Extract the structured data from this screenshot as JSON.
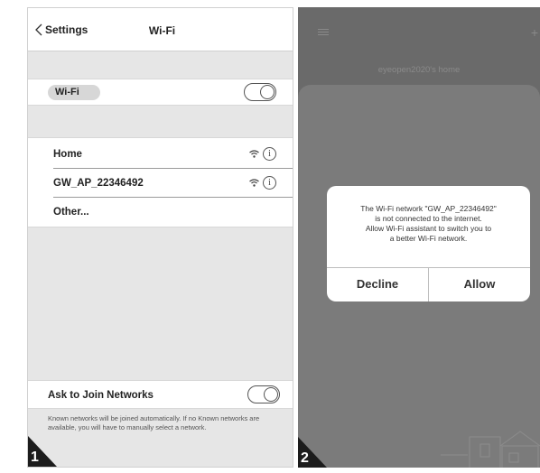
{
  "panel1": {
    "nav": {
      "back_label": "Settings",
      "title": "Wi-Fi"
    },
    "wifi": {
      "label": "Wi-Fi",
      "toggle": "off"
    },
    "networks": [
      {
        "name": "Home"
      },
      {
        "name": "GW_AP_22346492"
      },
      {
        "name": "Other..."
      }
    ],
    "ask_to_join": {
      "label": "Ask to Join Networks",
      "toggle": "off",
      "description": "Known networks will be joined automatically. If no Known networks are available, you will have to manually select a network."
    },
    "step_number": "1"
  },
  "panel2": {
    "home_title": "eyeopen2020's home",
    "plus_icon": "+",
    "dialog": {
      "message_line1": "The Wi-Fi network \"GW_AP_22346492\"",
      "message_line2": "is not connected to the internet.",
      "message_line3": "Allow Wi-Fi assistant to switch you to",
      "message_line4": "a better Wi-Fi network.",
      "decline_label": "Decline",
      "allow_label": "Allow"
    },
    "step_number": "2"
  },
  "icons": [
    "chevron-left-icon",
    "wifi-icon",
    "info-icon",
    "menu-icon",
    "plus-icon"
  ],
  "colors": {
    "overlay": "#6a6a6a",
    "sheet": "#7b7b7b",
    "panel_bg": "#e6e6e6",
    "dialog_bg": "#ffffff"
  }
}
